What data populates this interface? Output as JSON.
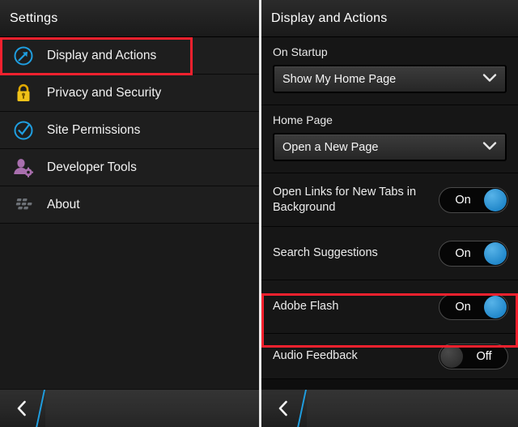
{
  "left_panel": {
    "header": {
      "title": "Settings"
    },
    "items": [
      {
        "label": "Display and Actions",
        "icon": "compass-arrow-icon",
        "highlighted": true
      },
      {
        "label": "Privacy and Security",
        "icon": "padlock-icon",
        "highlighted": false
      },
      {
        "label": "Site Permissions",
        "icon": "check-circle-icon",
        "highlighted": false
      },
      {
        "label": "Developer Tools",
        "icon": "person-gear-icon",
        "highlighted": false
      },
      {
        "label": "About",
        "icon": "blackberry-logo-icon",
        "highlighted": false
      }
    ],
    "bottom_bar": {
      "back_label": "back-chevron"
    }
  },
  "right_panel": {
    "header": {
      "title": "Display and Actions"
    },
    "sections": {
      "on_startup": {
        "label": "On Startup",
        "dropdown_value": "Show My Home Page",
        "chevron": "chevron-down-icon"
      },
      "home_page": {
        "label": "Home Page",
        "dropdown_value": "Open a New Page",
        "chevron": "chevron-down-icon"
      }
    },
    "toggles": [
      {
        "label": "Open Links for New Tabs in Background",
        "state": "On",
        "highlighted": false
      },
      {
        "label": "Search Suggestions",
        "state": "On",
        "highlighted": false
      },
      {
        "label": "Adobe Flash",
        "state": "On",
        "highlighted": true
      },
      {
        "label": "Audio Feedback",
        "state": "Off",
        "highlighted": false
      }
    ],
    "bottom_bar": {
      "back_label": "back-chevron"
    }
  },
  "colors": {
    "accent_blue": "#2389cb",
    "highlight_red": "#f3212e",
    "lock_gold": "#e8b40b",
    "dev_purple": "#a濃",
    "dev_purple_hex": "#a96fae",
    "icon_blue": "#1f9ee0",
    "bb_gray": "#6c7076"
  }
}
